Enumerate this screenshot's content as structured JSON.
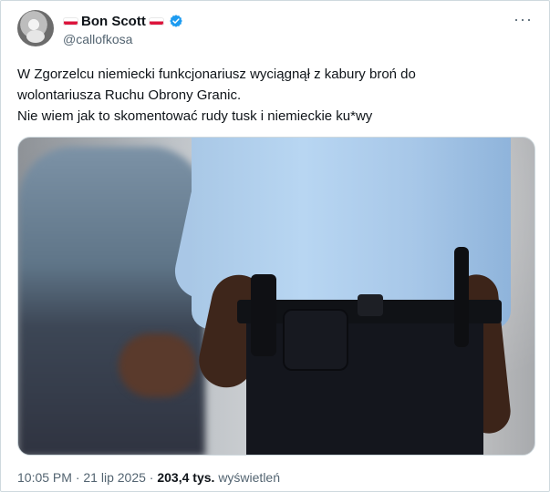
{
  "post": {
    "author_name": "Bon Scott",
    "handle": "@callofkosa",
    "more_label": "···",
    "text_lines": [
      "W Zgorzelcu niemiecki funkcjonariusz wyciągnął z kabury broń do",
      "wolontariusza Ruchu Obrony Granic.",
      "Nie wiem jak to skomentować rudy tusk i niemieckie ku*wy"
    ],
    "meta": {
      "time": "10:05 PM",
      "separator": "·",
      "date": "21 lip 2025",
      "views_count": "203,4 tys.",
      "views_label": "wyświetleń"
    }
  },
  "colors": {
    "text_primary": "#0f1419",
    "text_secondary": "#536471",
    "verified_blue": "#1d9bf0",
    "border": "#cfd9de",
    "flag_red": "#dc143c"
  },
  "icons": {
    "verified": "verified-badge-icon",
    "flag": "poland-flag-icon",
    "more": "more-options-icon"
  }
}
